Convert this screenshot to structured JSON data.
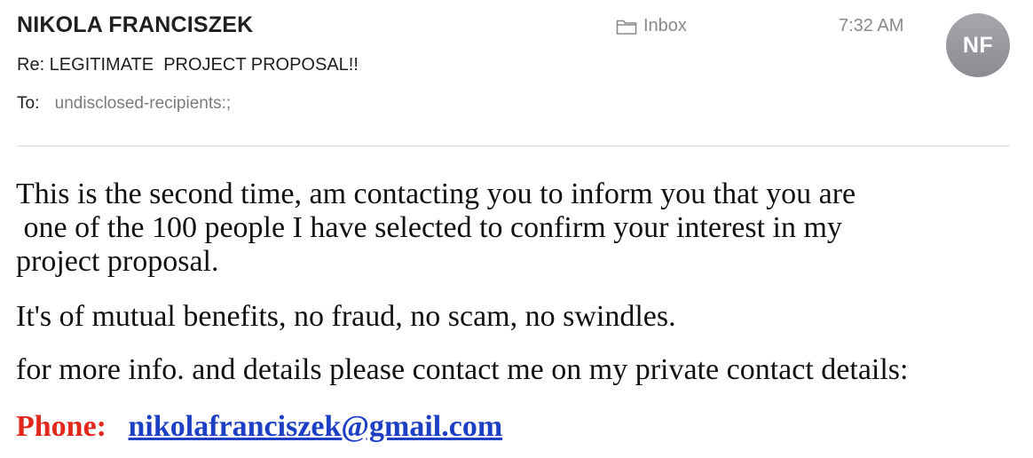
{
  "email": {
    "sender": "NIKOLA FRANCISZEK",
    "subject": "Re: LEGITIMATE  PROJECT PROPOSAL!!",
    "to_label": "To:",
    "to_value": "undisclosed-recipients:;",
    "mailbox": "Inbox",
    "time": "7:32 AM",
    "avatar_initials": "NF",
    "mailbox_icon": "folder-icon"
  },
  "body": {
    "paragraph1_line1": "This is the second time, am contacting you to inform you that you are",
    "paragraph1_line2": " one of the 100 people I have selected to confirm your interest in my",
    "paragraph1_line3": "project proposal.",
    "paragraph2": "It's of mutual benefits, no fraud, no scam, no swindles.",
    "paragraph3": "for more info. and details please contact me on my private contact details:",
    "phone_label": "Phone:",
    "email_link": "nikolafranciszek@gmail.com"
  },
  "colors": {
    "phone_label": "#e0281c",
    "link": "#1d3fc4",
    "avatar_bg": "#9a9ba0"
  }
}
